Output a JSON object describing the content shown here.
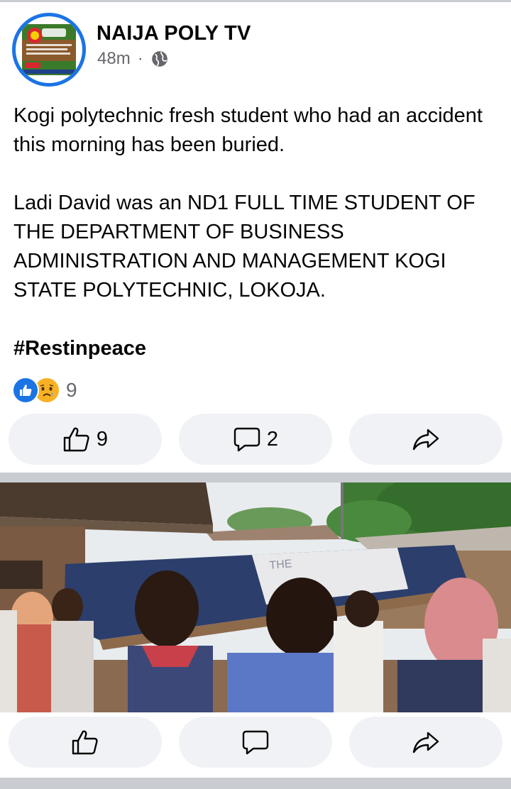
{
  "post": {
    "page_name": "NAIJA POLY TV",
    "time": "48m",
    "separator_dot": "·",
    "privacy_icon": "globe-icon",
    "paragraphs": [
      "Kogi polytechnic fresh student who had an accident this morning has been buried.",
      "Ladi David was an ND1 FULL TIME STUDENT OF THE DEPARTMENT OF BUSINESS ADMINISTRATION AND MANAGEMENT KOGI STATE POLYTECHNIC, LOKOJA."
    ],
    "hashtag": "#Restinpeace",
    "reaction_icons": [
      "like-icon",
      "sad-icon"
    ],
    "reaction_count": "9",
    "actions": [
      {
        "icon": "like-icon",
        "count": "9"
      },
      {
        "icon": "comment-icon",
        "count": "2"
      },
      {
        "icon": "share-icon",
        "count": ""
      }
    ]
  },
  "photo_post": {
    "coffin_text": "THE",
    "actions": [
      {
        "icon": "like-icon"
      },
      {
        "icon": "comment-icon"
      },
      {
        "icon": "share-icon"
      }
    ]
  },
  "colors": {
    "accent": "#1b74e4",
    "pill_bg": "#f0f2f5",
    "separator": "#c9ccd1",
    "secondary_text": "#65676b"
  }
}
